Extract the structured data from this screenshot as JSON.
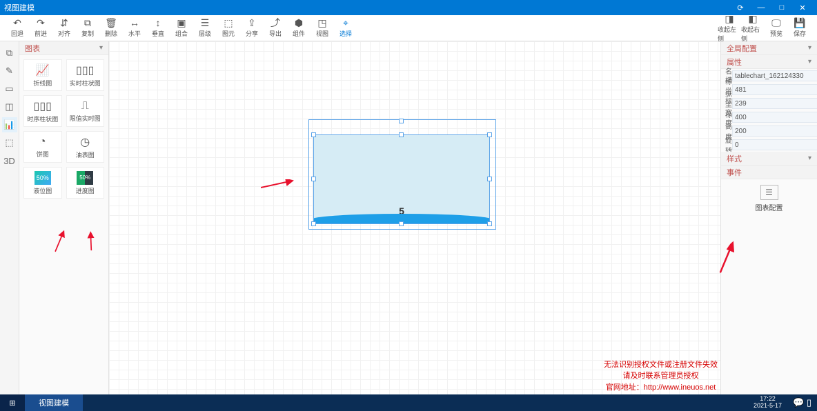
{
  "title": "视图建模",
  "toolbar": {
    "undo": "回退",
    "redo": "前进",
    "align": "对齐",
    "copy": "复制",
    "delete": "删除",
    "horiz": "水平",
    "vert": "垂直",
    "group": "组合",
    "stack": "层级",
    "element": "图元",
    "share": "分享",
    "export": "导出",
    "component": "组件",
    "view": "视图",
    "select": "选择",
    "collapseLeft": "收起左侧",
    "collapseRight": "收起右侧",
    "preview": "预览",
    "save": "保存"
  },
  "palette": {
    "header": "图表",
    "items": [
      {
        "label": "折线图",
        "icon": "line"
      },
      {
        "label": "实时柱状图",
        "icon": "bar"
      },
      {
        "label": "时序柱状图",
        "icon": "bar"
      },
      {
        "label": "限值实时图",
        "icon": "gauge"
      },
      {
        "label": "饼图",
        "icon": "pie"
      },
      {
        "label": "油表图",
        "icon": "gauge"
      },
      {
        "label": "液位图",
        "icon": "liquid",
        "badge": "50%"
      },
      {
        "label": "进度图",
        "icon": "progress",
        "badge": "50%"
      }
    ]
  },
  "rails": [
    "pointer",
    "wand",
    "shape",
    "shape2",
    "chart",
    "box",
    "3d"
  ],
  "right": {
    "global": "全局配置",
    "properties": "属性",
    "props": {
      "name_label": "名称",
      "name": "tablechart_162124330",
      "x_label": "横坐标",
      "x": "481",
      "y_label": "纵坐标",
      "y": "239",
      "w_label": "宽度",
      "w": "400",
      "h_label": "高度",
      "h": "200",
      "r_label": "旋转",
      "r": "0"
    },
    "style": "样式",
    "events": "事件",
    "eventBtn": "图表配置"
  },
  "canvas": {
    "chart_value": "5"
  },
  "warning": {
    "l1": "无法识别授权文件或注册文件失效",
    "l2": "请及时联系管理员授权",
    "l3a": "官网地址：",
    "l3b": "http://www.ineuos.net"
  },
  "taskbar": {
    "app": "视图建模",
    "time": "17:22",
    "date": "2021-5-17"
  }
}
